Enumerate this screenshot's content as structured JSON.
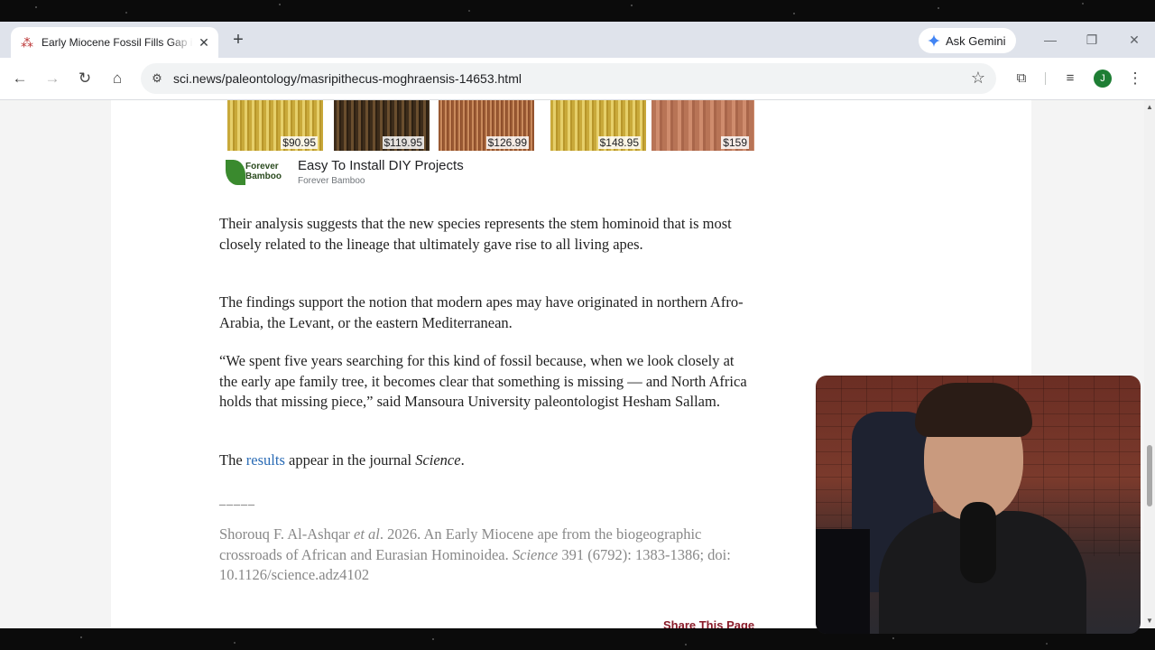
{
  "browser": {
    "tab_title": "Early Miocene Fossil Fills Gap in",
    "url": "sci.news/paleontology/masripithecus-moghraensis-14653.html",
    "ask_gemini": "Ask Gemini",
    "avatar_letter": "J"
  },
  "ad": {
    "products": [
      {
        "price": "$90.95",
        "style": "bamboo"
      },
      {
        "price": "$119.95",
        "style": "dark"
      },
      {
        "price": "$126.99",
        "style": "reed"
      },
      {
        "price": "$148.95",
        "style": "bamboo"
      },
      {
        "price": "$159",
        "style": "wood"
      }
    ],
    "logo_line1": "Forever",
    "logo_line2": "Bamboo",
    "title": "Easy To Install DIY Projects",
    "brand": "Forever Bamboo"
  },
  "article": {
    "p1": "Their analysis suggests that the new species represents the stem hominoid that is most closely related to the lineage that ultimately gave rise to all living apes.",
    "p2": "The findings support the notion that modern apes may have originated in northern Afro-Arabia, the Levant, or the eastern Mediterranean.",
    "p3": "“We spent five years searching for this kind of fossil because, when we look closely at the early ape family tree, it becomes clear that something is missing — and North Africa holds that missing piece,” said Mansoura University paleontologist Hesham Sallam.",
    "p4_prefix": "The ",
    "p4_link": "results",
    "p4_mid": " appear in the journal ",
    "p4_journal": "Science",
    "p4_end": ".",
    "rule": "_____",
    "cite_authors": "Shorouq F. Al-Ashqar ",
    "cite_etal": "et al",
    "cite_rest": ". 2026. An Early Miocene ape from the biogeographic crossroads of African and Eurasian Hominoidea. ",
    "cite_journal": "Science",
    "cite_tail": " 391 (6792): 1383-1386; doi: 10.1126/science.adz4102",
    "share_label": "Share This Page"
  },
  "icons": {
    "back": "arrow-left",
    "forward": "arrow-right",
    "reload": "reload",
    "home": "home",
    "bookmark": "star",
    "close": "x",
    "new_tab": "plus"
  }
}
